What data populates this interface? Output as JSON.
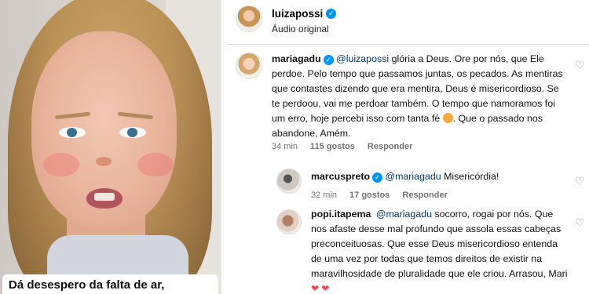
{
  "video": {
    "caption": "Dá desespero da falta de ar,"
  },
  "post": {
    "username": "luizapossi",
    "audio_label": "Áudio original"
  },
  "comments": [
    {
      "username": "mariagadu",
      "mention": "@luizapossi",
      "text_before_emoji": "glória a Deus. Ore por nós, que Ele perdoe. Pelo tempo que passamos juntas, os pecados. As mentiras que contastes dizendo que era mentira, Deus é misericordioso. Se te perdoou, vai me perdoar também. O tempo que namoramos foi um erro, hoje percebi isso com tanta fé",
      "emoji": "smiling-face-emoji",
      "text_after_emoji": ". Que o passado nos abandone, Amém.",
      "time": "34 min",
      "likes": "115 gostos",
      "reply_label": "Responder"
    },
    {
      "username": "marcuspreto",
      "mention": "@mariagadu",
      "text": "Misericórdia!",
      "time": "32 min",
      "likes": "17 gostos",
      "reply_label": "Responder"
    },
    {
      "username": "popi.itapema",
      "mention": "@mariagadu",
      "text": "socorro, rogai por nós. Que nos afaste desse mal profundo que assola essas cabeças preconceituosas. Que esse Deus misericordioso entenda de uma vez por todas que temos direitos de existir na maravilhosidade de pluralidade que ele criou. Arrasou, Mari",
      "hearts": "❤ ❤"
    }
  ],
  "colors": {
    "verified": "#0095f6",
    "mention": "#00376b",
    "meta": "#737373",
    "heart_red": "#ed4956"
  }
}
